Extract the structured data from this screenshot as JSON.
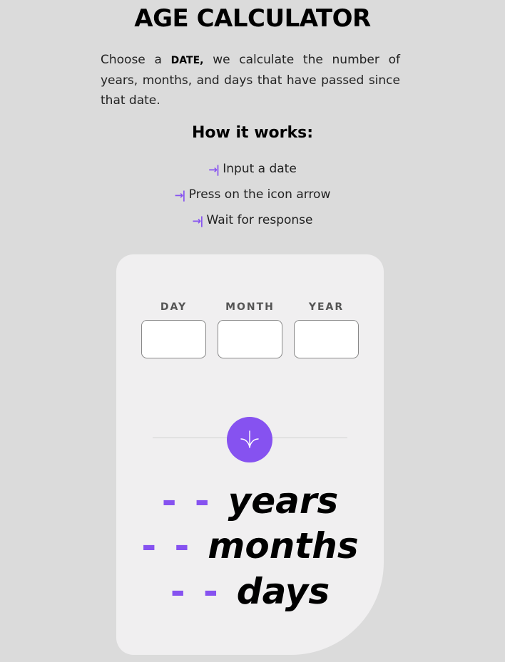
{
  "header": {
    "title": "AGE CALCULATOR",
    "intro_before": "Choose a",
    "intro_bold": "DATE,",
    "intro_after": "we calculate the number of years, months, and days that have passed since that date."
  },
  "how_it_works": {
    "title": "How it works:",
    "icon": "arrow-right-to-bar-icon",
    "steps": [
      "Input a date",
      "Press on the icon arrow",
      "Wait for response"
    ]
  },
  "form": {
    "day_label": "DAY",
    "month_label": "MONTH",
    "year_label": "YEAR",
    "day_value": "",
    "month_value": "",
    "year_value": "",
    "submit_icon": "arrow-down-icon"
  },
  "results": {
    "years_value": "- -",
    "years_unit": "years",
    "months_value": "- -",
    "months_unit": "months",
    "days_value": "- -",
    "days_unit": "days"
  },
  "colors": {
    "accent": "#8652f0",
    "background": "#dbdbdb",
    "card": "#f0eff0"
  }
}
